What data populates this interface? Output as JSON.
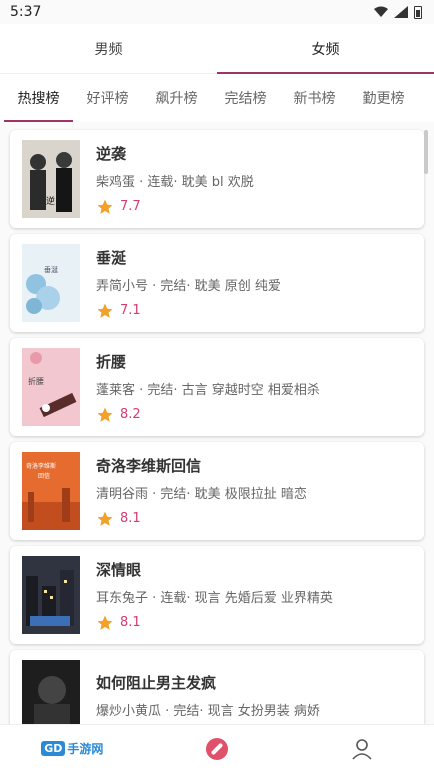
{
  "status": {
    "time": "5:37"
  },
  "gender_tabs": [
    {
      "label": "男频"
    },
    {
      "label": "女频"
    }
  ],
  "rank_tabs": [
    {
      "label": "热搜榜"
    },
    {
      "label": "好评榜"
    },
    {
      "label": "飙升榜"
    },
    {
      "label": "完结榜"
    },
    {
      "label": "新书榜"
    },
    {
      "label": "勤更榜"
    }
  ],
  "books": [
    {
      "title": "逆袭",
      "meta": "柴鸡蛋 · 连载· 耽美 bl 欢脱",
      "score": "7.7",
      "cover_color": "#d9d4cc"
    },
    {
      "title": "垂涎",
      "meta": "弄简小号 · 完结· 耽美 原创 纯爱",
      "score": "7.1",
      "cover_color": "#cfe4ef"
    },
    {
      "title": "折腰",
      "meta": "蓬莱客 · 完结· 古言 穿越时空 相爱相杀",
      "score": "8.2",
      "cover_color": "#f2c7cf"
    },
    {
      "title": "奇洛李维斯回信",
      "meta": "清明谷雨 · 完结· 耽美 极限拉扯 暗恋",
      "score": "8.1",
      "cover_color": "#e56b2e"
    },
    {
      "title": "深情眼",
      "meta": "耳东兔子 · 连载· 现言 先婚后爱 业界精英",
      "score": "8.1",
      "cover_color": "#2f3440"
    },
    {
      "title": "如何阻止男主发疯",
      "meta": "爆炒小黄瓜 · 完结· 现言 女扮男装 病娇",
      "score": "",
      "cover_color": "#1e1e1e"
    }
  ],
  "bottom_nav": {
    "logo_text": "手游网",
    "logo_badge": "GD"
  },
  "colors": {
    "accent": "#a0336a",
    "score": "#d73a74",
    "star": "#f2a12b"
  }
}
